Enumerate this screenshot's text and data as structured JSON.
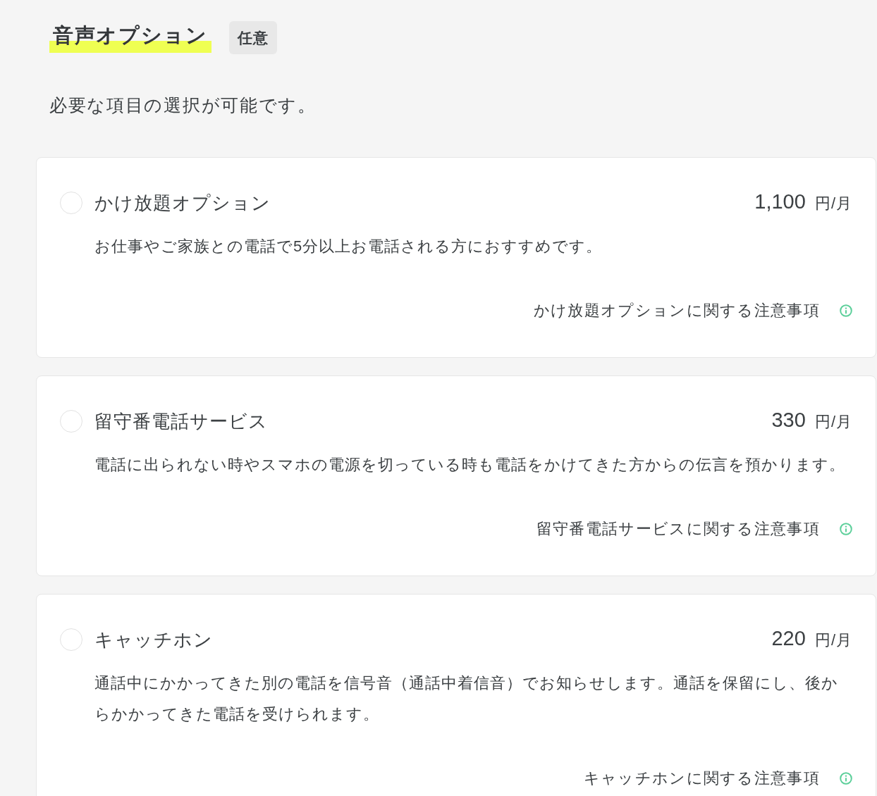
{
  "section": {
    "title": "音声オプション",
    "badge": "任意",
    "description": "必要な項目の選択が可能です。"
  },
  "options": [
    {
      "name": "かけ放題オプション",
      "price": "1,100",
      "unit": "円/月",
      "description": "お仕事やご家族との電話で5分以上お電話される方におすすめです。",
      "notice": "かけ放題オプションに関する注意事項",
      "selected": false
    },
    {
      "name": "留守番電話サービス",
      "price": "330",
      "unit": "円/月",
      "description": "電話に出られない時やスマホの電源を切っている時も電話をかけてきた方からの伝言を預かります。",
      "notice": "留守番電話サービスに関する注意事項",
      "selected": false
    },
    {
      "name": "キャッチホン",
      "price": "220",
      "unit": "円/月",
      "description": "通話中にかかってきた別の電話を信号音（通話中着信音）でお知らせします。通話を保留にし、後からかかってきた電話を受けられます。",
      "notice": "キャッチホンに関する注意事項",
      "selected": false
    }
  ]
}
